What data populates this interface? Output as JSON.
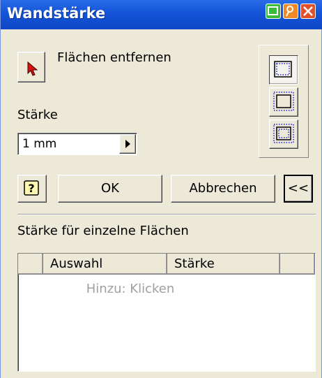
{
  "window": {
    "title": "Wandstärke",
    "title_buttons": [
      "minimize-icon",
      "restore-icon",
      "close-icon"
    ]
  },
  "select_button": {
    "icon": "arrow-pointer-icon",
    "label": "Flächen entfernen"
  },
  "thickness": {
    "label": "Stärke",
    "value": "1 mm",
    "arrow_icon": "triangle-right-icon"
  },
  "direction_buttons": [
    "inside-direction-icon",
    "outside-direction-icon",
    "both-directions-icon"
  ],
  "buttons": {
    "help_icon": "question-icon",
    "ok": "OK",
    "cancel": "Abbrechen",
    "collapse": "<<"
  },
  "individual_faces": {
    "title": "Stärke für einzelne Flächen",
    "columns": [
      "",
      "Auswahl",
      "Stärke",
      ""
    ],
    "placeholder": "Hinzu: Klicken"
  },
  "colors": {
    "titlebar": "#1454d8",
    "dialog_bg": "#ECE9D8",
    "close_button": "#e0502a",
    "minimize_button": "#3dba3d",
    "restore_button": "#f08a24"
  }
}
